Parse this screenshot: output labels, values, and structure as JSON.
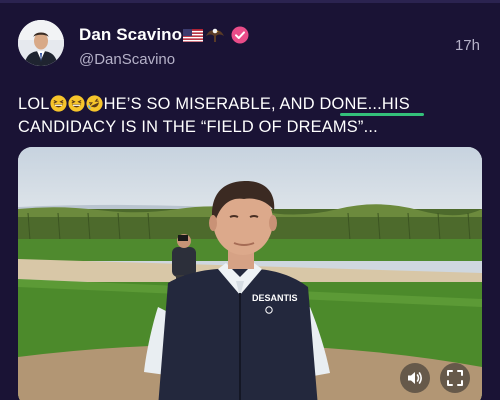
{
  "post": {
    "display_name": "Dan Scavino",
    "handle": "@DanScavino",
    "timestamp": "17h",
    "emoji_after_name": [
      "flag-usa-icon",
      "eagle-icon"
    ],
    "verified": true,
    "text_line1_prefix": "LOL",
    "text_line1_main": "HE’S SO MISERABLE, AND ",
    "text_line1_done": "DONE",
    "text_line1_suffix": "...HIS",
    "text_line2": "CANDIDACY IS IN THE “FIELD OF DREAMS”...",
    "laugh_emojis": [
      "grinning-squinting-face-icon",
      "grinning-squinting-face-icon",
      "rolling-on-floor-laughing-icon"
    ]
  },
  "media": {
    "type": "video",
    "vest_text": "DESANTIS",
    "controls": [
      "volume-icon",
      "fullscreen-icon"
    ]
  },
  "colors": {
    "background": "#1a1335",
    "secondary_text": "#b5b1c8",
    "verified_badge": "#ea4c89",
    "highlight_underline": "#34c17a"
  }
}
